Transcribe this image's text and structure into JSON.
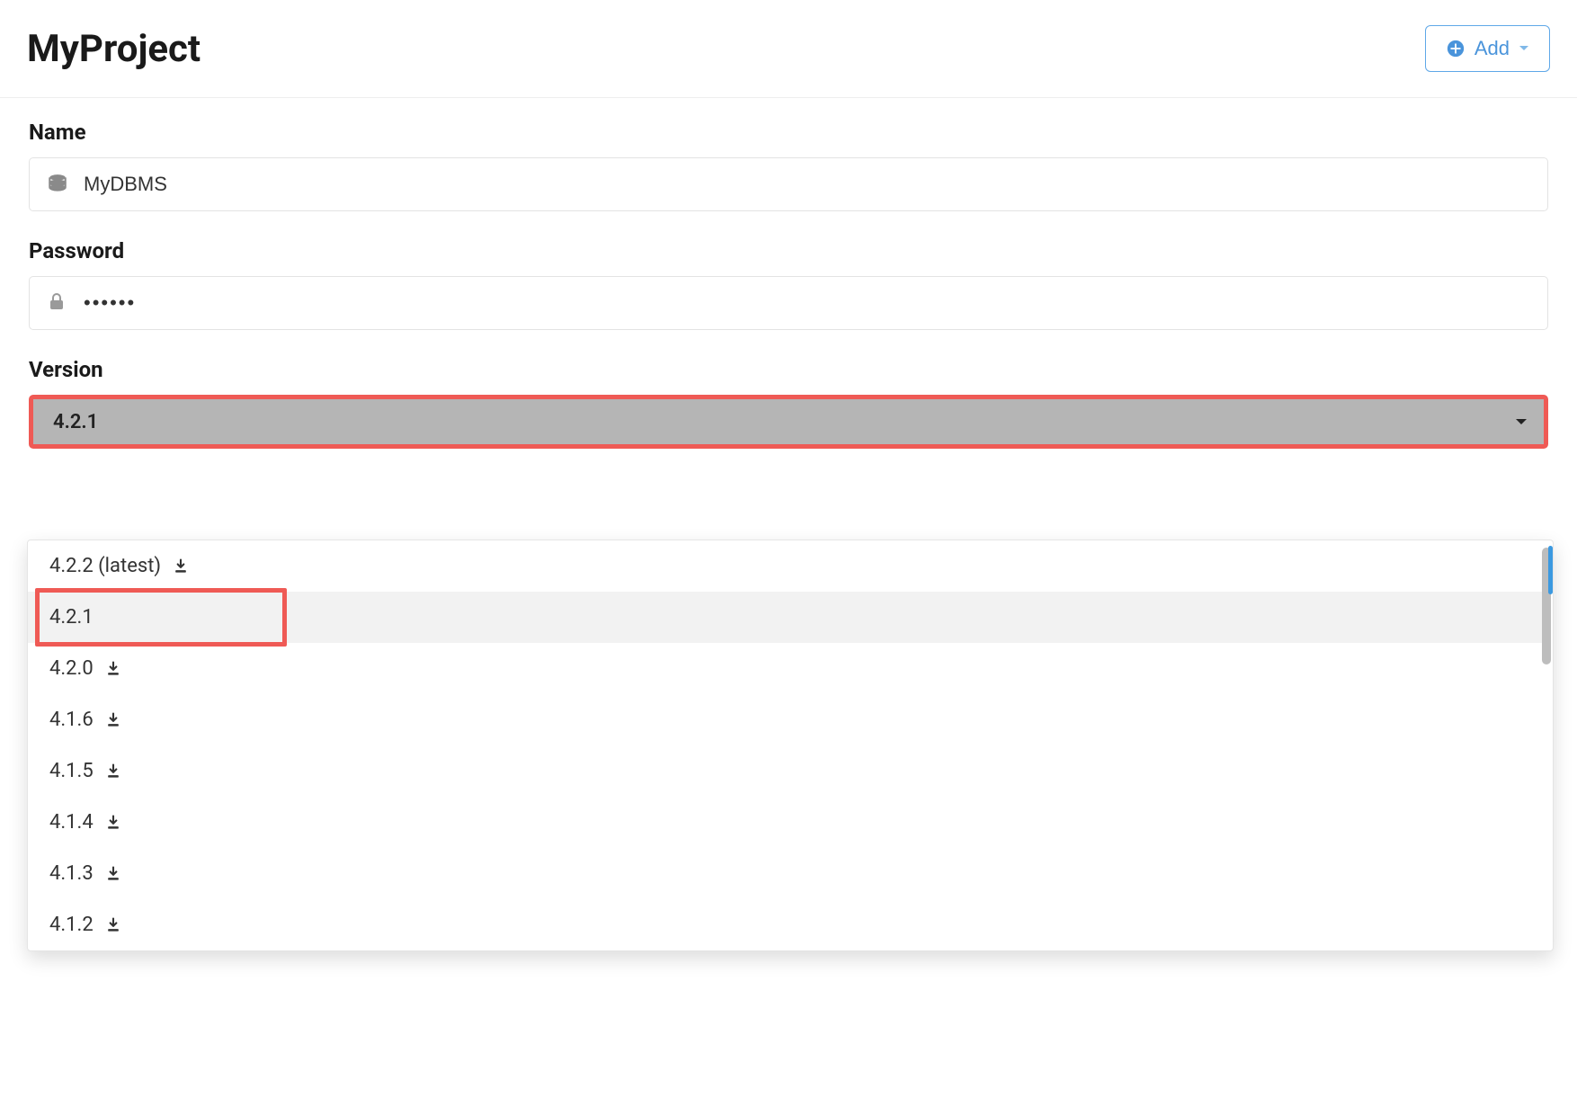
{
  "header": {
    "title": "MyProject",
    "add_label": "Add"
  },
  "form": {
    "name_label": "Name",
    "name_value": "MyDBMS",
    "password_label": "Password",
    "password_value": "••••••",
    "version_label": "Version",
    "version_selected": "4.2.1"
  },
  "version_options": [
    {
      "label": "4.2.2 (latest)",
      "downloadable": true,
      "selected": false
    },
    {
      "label": "4.2.1",
      "downloadable": false,
      "selected": true
    },
    {
      "label": "4.2.0",
      "downloadable": true,
      "selected": false
    },
    {
      "label": "4.1.6",
      "downloadable": true,
      "selected": false
    },
    {
      "label": "4.1.5",
      "downloadable": true,
      "selected": false
    },
    {
      "label": "4.1.4",
      "downloadable": true,
      "selected": false
    },
    {
      "label": "4.1.3",
      "downloadable": true,
      "selected": false
    },
    {
      "label": "4.1.2",
      "downloadable": true,
      "selected": false
    }
  ],
  "colors": {
    "accent": "#3b99e0",
    "highlight": "#ef5a55",
    "select_bg": "#b5b5b5"
  }
}
